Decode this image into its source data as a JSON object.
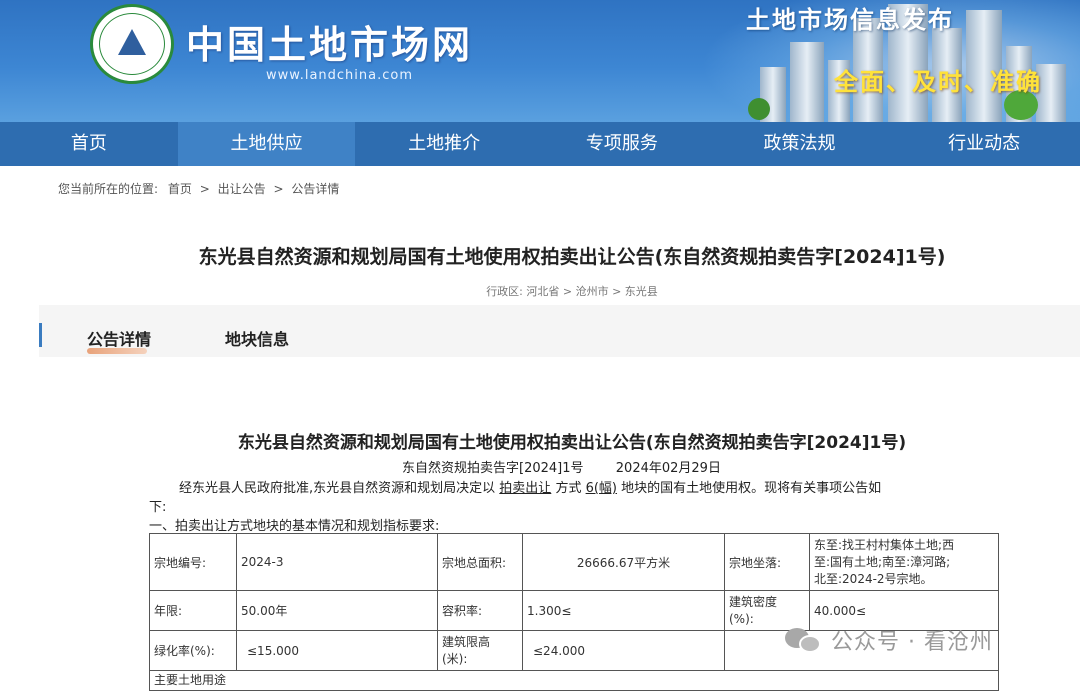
{
  "header": {
    "site_name": "中国土地市场网",
    "site_url": "www.landchina.com",
    "logo_text": "中国土地市场",
    "banner_title": "土地市场信息发布",
    "banner_slogan": "全面、及时、准确"
  },
  "nav": {
    "items": [
      "首页",
      "土地供应",
      "土地推介",
      "专项服务",
      "政策法规",
      "行业动态"
    ],
    "active_index": 1
  },
  "breadcrumb": {
    "prefix": "您当前所在的位置:",
    "items": [
      "首页",
      "出让公告",
      "公告详情"
    ],
    "separator": ">"
  },
  "page": {
    "title": "东光县自然资源和规划局国有土地使用权拍卖出让公告(东自然资规拍卖告字[2024]1号)",
    "region": "行政区:  河北省 > 沧州市 > 东光县"
  },
  "tabs": {
    "items": [
      "公告详情",
      "地块信息"
    ],
    "active_index": 0
  },
  "document": {
    "title": "东光县自然资源和规划局国有土地使用权拍卖出让公告(东自然资规拍卖告字[2024]1号)",
    "ref_no": "东自然资规拍卖告字[2024]1号",
    "date": "2024年02月29日",
    "intro_a": "经东光县人民政府批准,东光县自然资源和规划局决定以",
    "intro_method": "拍卖出让",
    "intro_b": "方式",
    "intro_count": "6(幅)",
    "intro_c": "地块的国有土地使用权。现将有关事项公告如",
    "intro_d": "下:",
    "section_1": "一、拍卖出让方式地块的基本情况和规划指标要求:",
    "next_row_label": "主要土地用途"
  },
  "parcel_table": {
    "row1": {
      "label_id": "宗地编号:",
      "id": "2024-3",
      "label_area": "宗地总面积:",
      "area": "26666.67平方米",
      "label_location": "宗地坐落:",
      "location_l1": "东至:找王村村集体土地;西",
      "location_l2": "至:国有土地;南至:漳河路;",
      "location_l3": "北至:2024-2号宗地。"
    },
    "row2": {
      "label_term": "年限:",
      "term": "50.00年",
      "label_far": "容积率:",
      "far": "1.300≤",
      "label_density_l1": "建筑密度",
      "label_density_l2": "(%):",
      "density": "40.000≤"
    },
    "row3": {
      "label_green": "绿化率(%):",
      "green": "≤15.000",
      "label_height_l1": "建筑限高",
      "label_height_l2": "(米):",
      "height": "≤24.000"
    }
  },
  "watermark": {
    "text": "公众号 · 看沧州",
    "icon": "wechat-icon"
  }
}
